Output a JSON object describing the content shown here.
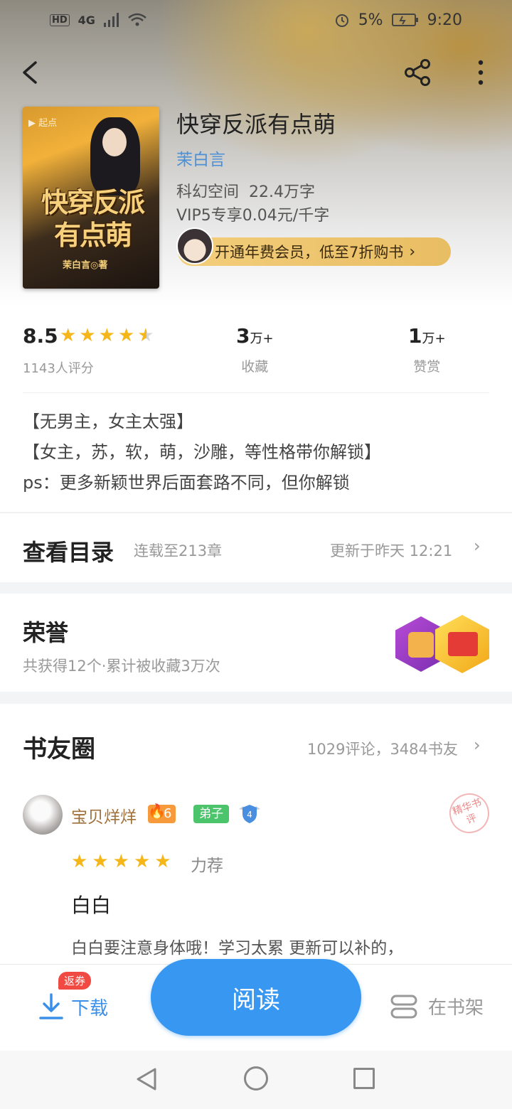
{
  "status_bar": {
    "signal": "4G",
    "battery": "5%",
    "time": "9:20"
  },
  "book": {
    "title": "快穿反派有点萌",
    "author": "茉白言",
    "category_words": "科幻空间  22.4万字",
    "price": "VIP5专享0.04元/千字",
    "vip_promo": "开通年费会员，低至7折购书"
  },
  "cover_art": {
    "title_line1": "快穿反派",
    "title_line2": "有点萌",
    "author": "茉白言◎著"
  },
  "stats": {
    "rating": "8.5",
    "rating_stars": 4.5,
    "rating_count": "1143人评分",
    "favorites_num": "3",
    "favorites_unit": "万+",
    "favorites_label": "收藏",
    "tips_num": "1",
    "tips_unit": "万+",
    "tips_label": "赞赏"
  },
  "description": [
    "【无男主，女主太强】",
    "【女主，苏，软，萌，沙雕，等性格带你解锁】",
    "ps：更多新颖世界后面套路不同，但你解锁"
  ],
  "catalog": {
    "title": "查看目录",
    "progress": "连载至213章",
    "updated": "更新于昨天 12:21"
  },
  "honor": {
    "title": "荣誉",
    "summary": "共获得12个·累计被收藏3万次"
  },
  "book_circle": {
    "title": "书友圈",
    "counts": "1029评论，3484书友",
    "review": {
      "user": "宝贝烊烊",
      "fire_level": "6",
      "role_badge": "弟子",
      "shield_level": "4",
      "stamp": "精华书评",
      "stars": 5,
      "recommend": "力荐",
      "headline": "白白",
      "body": "白白要注意身体哦！学习太累 更新可以补的，"
    }
  },
  "bottom_bar": {
    "coupon": "返券",
    "download": "下载",
    "read": "阅读",
    "shelf": "在书架"
  },
  "colors": {
    "accent": "#3897f0",
    "author_link": "#4a90d9",
    "star": "#f5b619",
    "vip_gold": "#f4ce7c"
  }
}
